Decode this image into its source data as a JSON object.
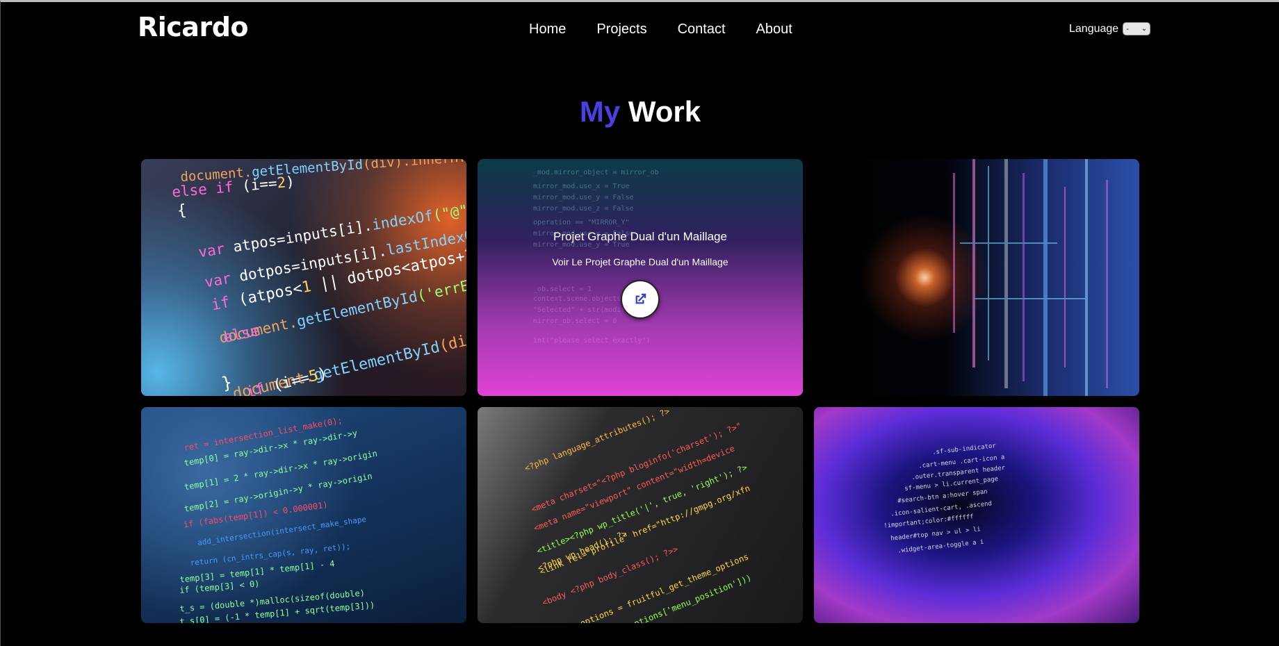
{
  "brand": {
    "logo": "Ricardo"
  },
  "nav": {
    "items": [
      "Home",
      "Projects",
      "Contact",
      "About"
    ]
  },
  "language": {
    "label": "Language",
    "selected": "-"
  },
  "section": {
    "title_accent": "My",
    "title_rest": "Work"
  },
  "projects": [
    {
      "hover_title": "",
      "hover_link": ""
    },
    {
      "hover_title": "Projet Graphe Dual d'un Maillage",
      "hover_link": "Voir Le Projet Graphe Dual d'un Maillage"
    },
    {
      "hover_title": "",
      "hover_link": ""
    },
    {
      "hover_title": "",
      "hover_link": ""
    },
    {
      "hover_title": "",
      "hover_link": ""
    },
    {
      "hover_title": "",
      "hover_link": ""
    }
  ],
  "colors": {
    "accent": "#4a3fe0",
    "background": "#000000",
    "text": "#ffffff"
  },
  "icons": {
    "project_link": "external-link-icon",
    "dropdown": "chevron-down-icon"
  }
}
